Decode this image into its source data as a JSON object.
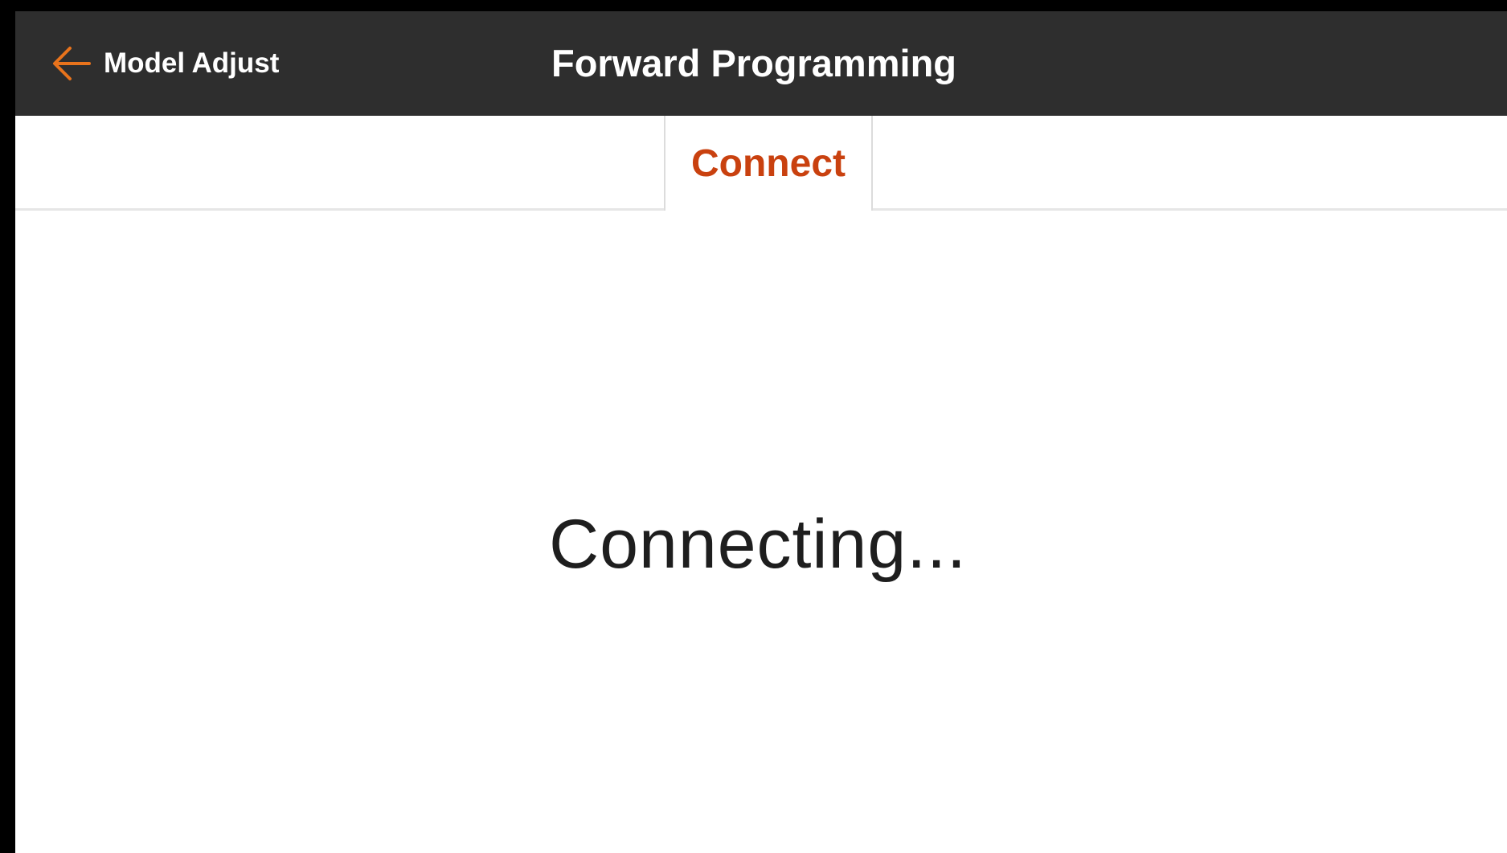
{
  "header": {
    "back_label": "Model Adjust",
    "back_icon": "arrow-left-icon",
    "title": "Forward Programming"
  },
  "tabs": [
    {
      "label": "Connect",
      "active": true
    }
  ],
  "main": {
    "status": "Connecting..."
  },
  "colors": {
    "header_bg": "#2e2e2e",
    "accent": "#e8731c",
    "tab_text": "#c9410f",
    "status_text": "#1e1e1e"
  }
}
